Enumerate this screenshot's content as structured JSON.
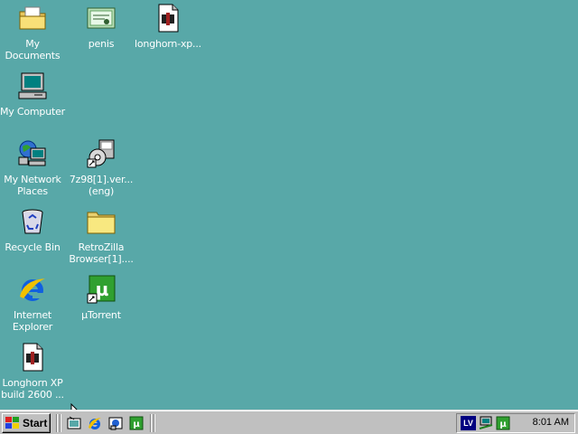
{
  "desktop": {
    "background_color": "#58a8a8",
    "icons": [
      {
        "label": "My Documents",
        "icon": "folder-documents-icon"
      },
      {
        "label": "penis",
        "icon": "certificate-file-icon"
      },
      {
        "label": "longhorn-xp...",
        "icon": "media-file-icon"
      },
      {
        "label": "My Computer",
        "icon": "computer-icon"
      },
      {
        "label": "My Network\nPlaces",
        "icon": "network-places-icon"
      },
      {
        "label": "7z98[1].ver...\n(eng)",
        "icon": "installer-shortcut-icon"
      },
      {
        "label": "Recycle Bin",
        "icon": "recycle-bin-icon"
      },
      {
        "label": "RetroZilla\nBrowser[1]....",
        "icon": "folder-icon"
      },
      {
        "label": "Internet\nExplorer",
        "icon": "internet-explorer-icon"
      },
      {
        "label": "µTorrent",
        "icon": "utorrent-shortcut-icon"
      },
      {
        "label": "Longhorn XP\nbuild 2600 ...",
        "icon": "media-file-icon"
      }
    ]
  },
  "taskbar": {
    "start_label": "Start",
    "quick_launch": [
      "show-desktop-icon",
      "internet-explorer-icon",
      "channels-icon",
      "utorrent-icon"
    ],
    "tray": {
      "language": "LV",
      "tray_icons": [
        "network-tray-icon",
        "utorrent-tray-icon"
      ],
      "clock": "8:01 AM"
    }
  }
}
